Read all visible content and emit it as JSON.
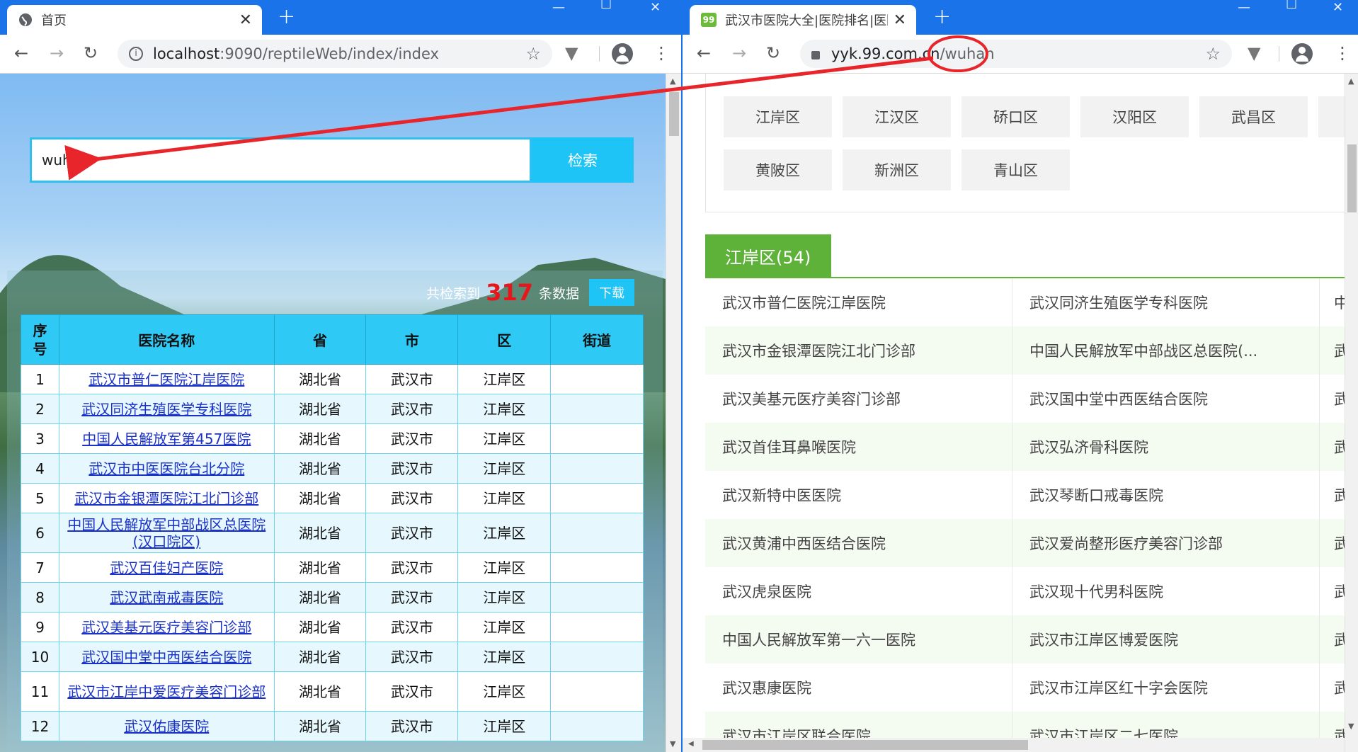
{
  "left": {
    "tab_title": "首页",
    "url_host": "localhost",
    "url_rest": ":9090/reptileWeb/index/index",
    "search_value": "wuhan",
    "search_button": "检索",
    "summary_prefix": "共检索到",
    "result_count": "317",
    "summary_suffix": "条数据",
    "download_button": "下载",
    "table": {
      "headers": [
        "序号",
        "医院名称",
        "省",
        "市",
        "区",
        "街道"
      ],
      "rows": [
        [
          "1",
          "武汉市普仁医院江岸医院",
          "湖北省",
          "武汉市",
          "江岸区",
          ""
        ],
        [
          "2",
          "武汉同济生殖医学专科医院",
          "湖北省",
          "武汉市",
          "江岸区",
          ""
        ],
        [
          "3",
          "中国人民解放军第457医院",
          "湖北省",
          "武汉市",
          "江岸区",
          ""
        ],
        [
          "4",
          "武汉市中医医院台北分院",
          "湖北省",
          "武汉市",
          "江岸区",
          ""
        ],
        [
          "5",
          "武汉市金银潭医院江北门诊部",
          "湖北省",
          "武汉市",
          "江岸区",
          ""
        ],
        [
          "6",
          "中国人民解放军中部战区总医院(汉口院区)",
          "湖北省",
          "武汉市",
          "江岸区",
          ""
        ],
        [
          "7",
          "武汉百佳妇产医院",
          "湖北省",
          "武汉市",
          "江岸区",
          ""
        ],
        [
          "8",
          "武汉武南戒毒医院",
          "湖北省",
          "武汉市",
          "江岸区",
          ""
        ],
        [
          "9",
          "武汉美基元医疗美容门诊部",
          "湖北省",
          "武汉市",
          "江岸区",
          ""
        ],
        [
          "10",
          "武汉国中堂中西医结合医院",
          "湖北省",
          "武汉市",
          "江岸区",
          ""
        ],
        [
          "11",
          "武汉市江岸中爱医疗美容门诊部",
          "湖北省",
          "武汉市",
          "江岸区",
          ""
        ],
        [
          "12",
          "武汉佑康医院",
          "湖北省",
          "武汉市",
          "江岸区",
          ""
        ]
      ]
    }
  },
  "right": {
    "tab_title": "武汉市医院大全|医院排名|医院等",
    "favicon_text": "99",
    "url_host": "yyk.99.com.cn",
    "url_path": "/wuhan",
    "districts": [
      "江岸区",
      "江汉区",
      "硚口区",
      "汉阳区",
      "武昌区",
      "黄陂区",
      "新洲区",
      "青山区"
    ],
    "section_tab": "江岸区(54)",
    "hospital_rows": [
      [
        "武汉市普仁医院江岸医院",
        "武汉同济生殖医学专科医院",
        "中"
      ],
      [
        "武汉市金银潭医院江北门诊部",
        "中国人民解放军中部战区总医院(...",
        "武"
      ],
      [
        "武汉美基元医疗美容门诊部",
        "武汉国中堂中西医结合医院",
        "武"
      ],
      [
        "武汉首佳耳鼻喉医院",
        "武汉弘济骨科医院",
        "武"
      ],
      [
        "武汉新特中医医院",
        "武汉琴断口戒毒医院",
        "武"
      ],
      [
        "武汉黄浦中西医结合医院",
        "武汉爱尚整形医疗美容门诊部",
        "武"
      ],
      [
        "武汉虎泉医院",
        "武汉现十代男科医院",
        "武"
      ],
      [
        "中国人民解放军第一六一医院",
        "武汉市江岸区博爱医院",
        "武"
      ],
      [
        "武汉惠康医院",
        "武汉市江岸区红十字会医院",
        "武"
      ],
      [
        "武汉市江岸区联合医院",
        "武汉市江岸区二七医院",
        "武"
      ]
    ]
  },
  "colors": {
    "chrome_blue": "#1a73e8",
    "search_cyan": "#1ec4f6",
    "count_red": "#e8151b",
    "section_green": "#5eb23a",
    "annotation_red": "#e8252b"
  }
}
